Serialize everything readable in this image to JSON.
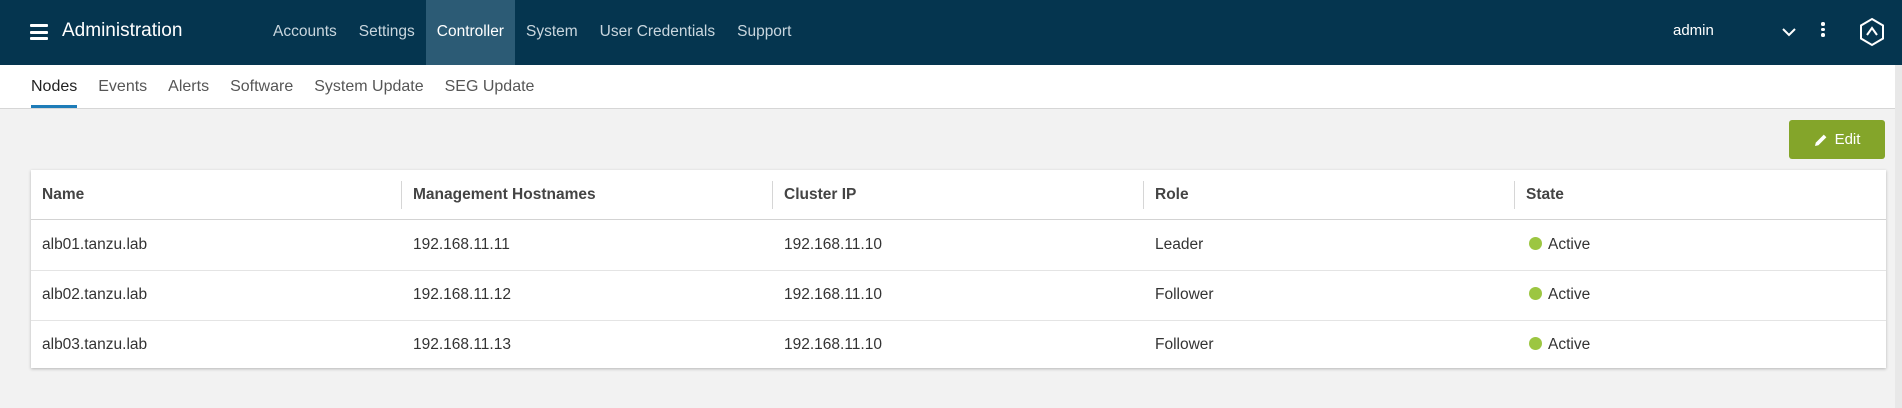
{
  "header": {
    "menu_icon": "hamburger-icon",
    "app_title": "Administration",
    "nav": [
      {
        "label": "Accounts",
        "active": false
      },
      {
        "label": "Settings",
        "active": false
      },
      {
        "label": "Controller",
        "active": true
      },
      {
        "label": "System",
        "active": false
      },
      {
        "label": "User Credentials",
        "active": false
      },
      {
        "label": "Support",
        "active": false
      }
    ],
    "user": "admin",
    "icons": [
      "chevron-down-icon",
      "kebab-menu-icon",
      "logo-icon"
    ],
    "background_color": "#05354f",
    "active_nav_color": "#2c5b75"
  },
  "subtabs": [
    {
      "label": "Nodes",
      "active": true
    },
    {
      "label": "Events",
      "active": false
    },
    {
      "label": "Alerts",
      "active": false
    },
    {
      "label": "Software",
      "active": false
    },
    {
      "label": "System Update",
      "active": false
    },
    {
      "label": "SEG Update",
      "active": false
    }
  ],
  "toolbar": {
    "edit_label": "Edit",
    "edit_icon": "pencil-icon",
    "edit_color": "#84a52a"
  },
  "table": {
    "columns": [
      "Name",
      "Management Hostnames",
      "Cluster IP",
      "Role",
      "State"
    ],
    "rows": [
      {
        "name": "alb01.tanzu.lab",
        "hostname": "192.168.11.11",
        "cluster_ip": "192.168.11.10",
        "role": "Leader",
        "state": "Active"
      },
      {
        "name": "alb02.tanzu.lab",
        "hostname": "192.168.11.12",
        "cluster_ip": "192.168.11.10",
        "role": "Follower",
        "state": "Active"
      },
      {
        "name": "alb03.tanzu.lab",
        "hostname": "192.168.11.13",
        "cluster_ip": "192.168.11.10",
        "role": "Follower",
        "state": "Active"
      }
    ],
    "state_color": "#9cc641"
  }
}
